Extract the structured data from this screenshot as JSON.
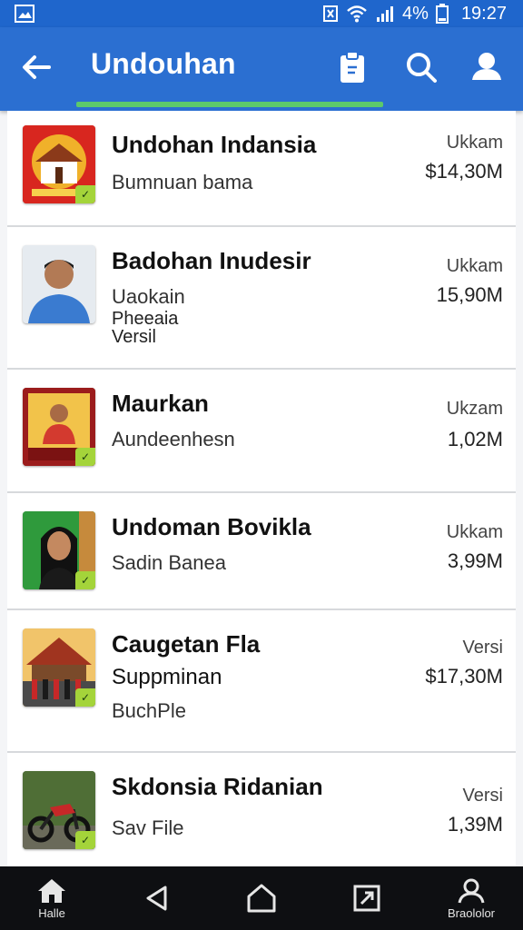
{
  "status_bar": {
    "battery": "4%",
    "time": "19:27"
  },
  "app_bar": {
    "title": "Undouhan"
  },
  "items": [
    {
      "title": "Undohan Indansia",
      "subtitle": "Bumnuan bama",
      "label": "Ukkam",
      "size": "$14,30M"
    },
    {
      "title": "Badohan Inudesir",
      "subtitle": "Uaokain",
      "extra1": "Pheeaia",
      "extra2": "Versil",
      "label": "Ukkam",
      "size": "15,90M"
    },
    {
      "title": "Maurkan",
      "subtitle": "Aundeenhesn",
      "label": "Ukzam",
      "size": "1,02M"
    },
    {
      "title": "Undoman Bovikla",
      "subtitle": "Sadin Banea",
      "label": "Ukkam",
      "size": "3,99M"
    },
    {
      "title": "Caugetan Fla",
      "subtitle": "Suppminan",
      "extra1": "BuchPle",
      "label": "Versi",
      "size": "$17,30M"
    },
    {
      "title": "Skdonsia Ridanian",
      "subtitle": "Sav File",
      "label": "Versi",
      "size": "1,39M"
    }
  ],
  "nav": {
    "home_label": "Halle",
    "profile_label": "Braololor"
  },
  "colors": {
    "app_bar": "#2b6fd1",
    "status_bar": "#1f66cc",
    "tab_indicator": "#5cc96b",
    "badge": "#a4d43a",
    "nav_bar": "#0e0f12"
  }
}
